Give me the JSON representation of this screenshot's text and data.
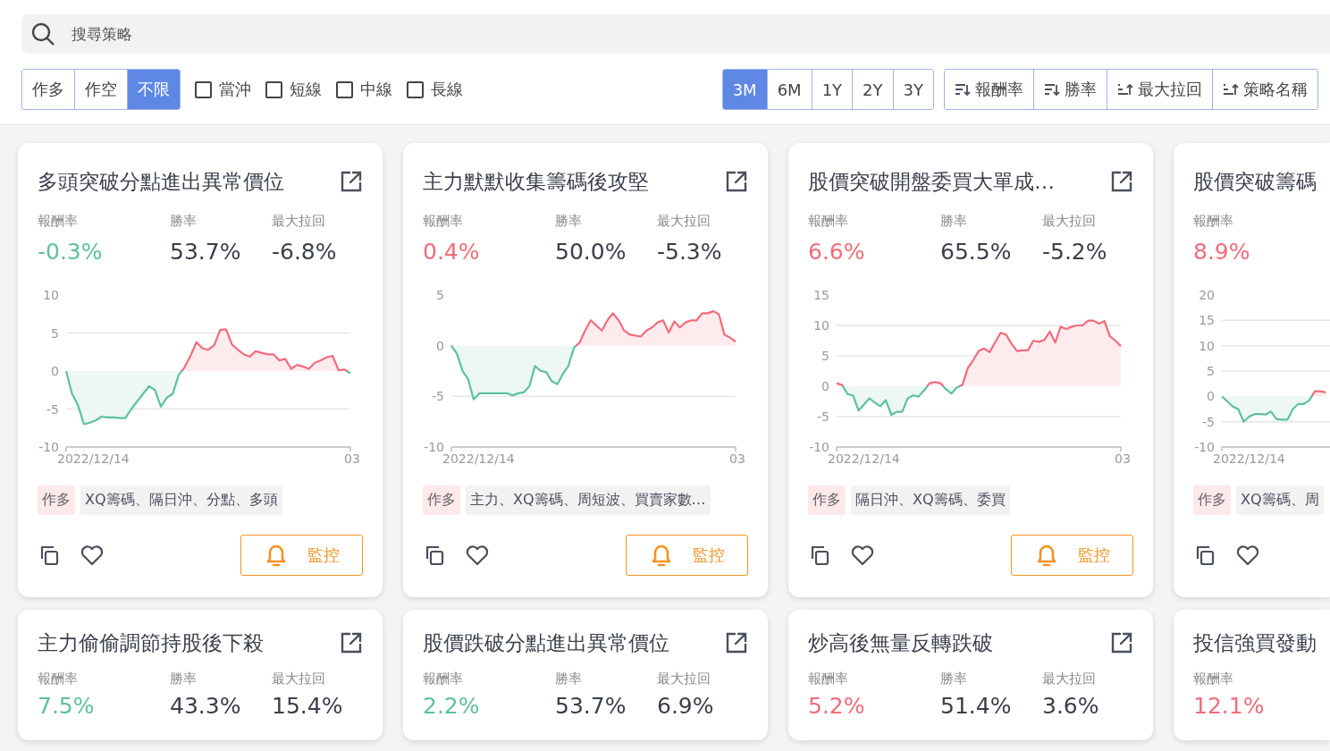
{
  "search": {
    "placeholder": "搜尋策略"
  },
  "direction_options": [
    {
      "label": "作多",
      "selected": false
    },
    {
      "label": "作空",
      "selected": false
    },
    {
      "label": "不限",
      "selected": true
    }
  ],
  "holding_filters": [
    {
      "label": "當沖",
      "checked": false
    },
    {
      "label": "短線",
      "checked": false
    },
    {
      "label": "中線",
      "checked": false
    },
    {
      "label": "長線",
      "checked": false
    }
  ],
  "periods": [
    {
      "label": "3M",
      "selected": true
    },
    {
      "label": "6M",
      "selected": false
    },
    {
      "label": "1Y",
      "selected": false
    },
    {
      "label": "2Y",
      "selected": false
    },
    {
      "label": "3Y",
      "selected": false
    }
  ],
  "sort_buttons": [
    {
      "label": "報酬率",
      "kind": "descending"
    },
    {
      "label": "勝率",
      "kind": "descending"
    },
    {
      "label": "最大拉回",
      "kind": "ascending"
    },
    {
      "label": "策略名稱",
      "kind": "ascending"
    }
  ],
  "cards": [
    {
      "title": "多頭突破分點進出異常價位",
      "stats": [
        {
          "label": "報酬率",
          "value": "-0.3%",
          "color": "#5cc29a"
        },
        {
          "label": "勝率",
          "value": "53.7%"
        },
        {
          "label": "最大拉回",
          "value": "-6.8%"
        }
      ],
      "chart_data": {
        "type": "area",
        "grid": true,
        "ylim": [
          -10,
          10
        ],
        "yticks": [
          -10,
          -5,
          0,
          5,
          10
        ],
        "series": [
          {
            "values": [
              0,
              -3,
              -4.5,
              -7,
              -6.8,
              -6.5,
              -6,
              -6.1,
              -6.1,
              -6.2,
              -6.2,
              -5,
              -4,
              -3,
              -2,
              -2.5,
              -4.7,
              -3.5,
              -3,
              -0.5,
              0.5,
              2,
              3.8,
              3,
              2.8,
              3.4,
              5.4,
              5.5,
              3.5,
              2.8,
              2.2,
              1.9,
              2.6,
              2.4,
              2.2,
              2.2,
              1.4,
              1.6,
              0.3,
              0.8,
              0.6,
              0.3,
              1.1,
              1.4,
              1.8,
              2,
              0.1,
              0.2,
              -0.3
            ]
          }
        ]
      },
      "date_start": "2022/12/14",
      "date_end": "03",
      "side": {
        "label": "作多",
        "kind": "long"
      },
      "keywords": "XQ籌碼、隔日沖、分點、多頭",
      "monitor": "監控"
    },
    {
      "title": "主力默默收集籌碼後攻堅",
      "stats": [
        {
          "label": "報酬率",
          "value": "0.4%",
          "color": "#f26b7a"
        },
        {
          "label": "勝率",
          "value": "50.0%"
        },
        {
          "label": "最大拉回",
          "value": "-5.3%"
        }
      ],
      "chart_data": {
        "type": "area",
        "grid": true,
        "ylim": [
          -10,
          5
        ],
        "yticks": [
          -10,
          -5,
          0,
          5
        ],
        "series": [
          {
            "values": [
              0,
              -0.8,
              -2.5,
              -3.3,
              -5.3,
              -4.7,
              -4.7,
              -4.7,
              -4.7,
              -4.7,
              -4.7,
              -4.9,
              -4.7,
              -4.6,
              -4,
              -2,
              -2.5,
              -2.6,
              -3.5,
              -3.8,
              -2.8,
              -2,
              -0.2,
              0.3,
              1.5,
              2.5,
              2,
              1.5,
              2.5,
              3.2,
              2.5,
              1.5,
              1.1,
              1,
              0.9,
              1.5,
              1.8,
              2.3,
              2.5,
              1.3,
              2.4,
              1.8,
              2.3,
              2.5,
              2.5,
              3.2,
              3.2,
              3.4,
              3.1,
              1.1,
              0.8,
              0.4
            ]
          }
        ]
      },
      "date_start": "2022/12/14",
      "date_end": "03",
      "side": {
        "label": "作多",
        "kind": "long"
      },
      "keywords": "主力、XQ籌碼、周短波、買賣家數…",
      "monitor": "監控"
    },
    {
      "title": "股價突破開盤委買大單成…",
      "stats": [
        {
          "label": "報酬率",
          "value": "6.6%",
          "color": "#f26b7a"
        },
        {
          "label": "勝率",
          "value": "65.5%"
        },
        {
          "label": "最大拉回",
          "value": "-5.2%"
        }
      ],
      "chart_data": {
        "type": "area",
        "grid": true,
        "ylim": [
          -10,
          15
        ],
        "yticks": [
          -10,
          -5,
          0,
          5,
          10,
          15
        ],
        "series": [
          {
            "values": [
              0.5,
              0.2,
              -1.3,
              -1.5,
              -4,
              -3,
              -2,
              -2.7,
              -3.3,
              -2.3,
              -4.7,
              -4.2,
              -4.2,
              -2,
              -1.5,
              -1.7,
              -0.7,
              0.5,
              0.7,
              0.5,
              -0.5,
              -1.2,
              -0.2,
              0.2,
              3,
              4.3,
              5.8,
              6.2,
              5.6,
              7.2,
              8.8,
              8.5,
              7,
              5.8,
              5.9,
              5.9,
              7.5,
              7.3,
              7.6,
              9,
              7.2,
              9.8,
              9.4,
              9.8,
              10,
              10,
              10.8,
              10.8,
              10.3,
              10.7,
              8.2,
              7.5,
              6.6
            ]
          }
        ]
      },
      "date_start": "2022/12/14",
      "date_end": "03",
      "side": {
        "label": "作多",
        "kind": "long"
      },
      "keywords": "隔日沖、XQ籌碼、委買",
      "monitor": "監控"
    },
    {
      "title": "股價突破籌碼",
      "stats": [
        {
          "label": "報酬率",
          "value": "8.9%",
          "color": "#f26b7a"
        }
      ],
      "chart_data": {
        "type": "area",
        "grid": true,
        "ylim": [
          -10,
          20
        ],
        "yticks": [
          -10,
          -5,
          0,
          5,
          10,
          15,
          20
        ],
        "series": [
          {
            "values": [
              0,
              -1,
              -2,
              -2.5,
              -5,
              -4,
              -3.5,
              -3.5,
              -3.6,
              -3,
              -4.5,
              -4.6,
              -4.6,
              -2.5,
              -1.5,
              -1.5,
              -0.8,
              1,
              1,
              0.8
            ]
          }
        ]
      },
      "date_start": "2022/12/14",
      "side": {
        "label": "作多",
        "kind": "long"
      },
      "keywords": "XQ籌碼、周"
    },
    {
      "title": "主力偷偷調節持股後下殺",
      "stats": [
        {
          "label": "報酬率",
          "value": "7.5%",
          "color": "#5cc29a"
        },
        {
          "label": "勝率",
          "value": "43.3%"
        },
        {
          "label": "最大拉回",
          "value": "15.4%"
        }
      ]
    },
    {
      "title": "股價跌破分點進出異常價位",
      "stats": [
        {
          "label": "報酬率",
          "value": "2.2%",
          "color": "#5cc29a"
        },
        {
          "label": "勝率",
          "value": "53.7%"
        },
        {
          "label": "最大拉回",
          "value": "6.9%"
        }
      ]
    },
    {
      "title": "炒高後無量反轉跌破",
      "stats": [
        {
          "label": "報酬率",
          "value": "5.2%",
          "color": "#f26b7a"
        },
        {
          "label": "勝率",
          "value": "51.4%"
        },
        {
          "label": "最大拉回",
          "value": "3.6%"
        }
      ]
    },
    {
      "title": "投信強買發動",
      "stats": [
        {
          "label": "報酬率",
          "value": "12.1%",
          "color": "#f26b7a"
        }
      ]
    }
  ]
}
